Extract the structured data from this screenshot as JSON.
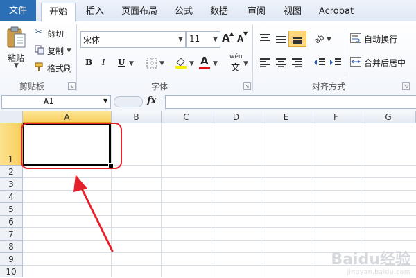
{
  "tabs": [
    "文件",
    "开始",
    "插入",
    "页面布局",
    "公式",
    "数据",
    "审阅",
    "视图",
    "Acrobat"
  ],
  "clipboard": {
    "paste": "粘贴",
    "cut": "剪切",
    "copy": "复制",
    "format_painter": "格式刷",
    "group_label": "剪贴板"
  },
  "font": {
    "name": "宋体",
    "size": "11",
    "group_label": "字体",
    "grow": "A",
    "shrink": "A",
    "bold": "B",
    "italic": "I",
    "underline": "U",
    "font_color_glyph": "A",
    "phonetic_glyph": "wén"
  },
  "alignment": {
    "wrap_text": "自动换行",
    "merge_center": "合并后居中",
    "group_label": "对齐方式"
  },
  "formula_bar": {
    "name_box": "A1",
    "fx": "fx",
    "content": ""
  },
  "sheet": {
    "columns": [
      "A",
      "B",
      "C",
      "D",
      "E",
      "F",
      "G"
    ],
    "rows": [
      "1",
      "2",
      "3",
      "4",
      "5",
      "6",
      "7",
      "8",
      "9",
      "10"
    ],
    "selected_cell": "A1"
  },
  "colors": {
    "file_tab": "#2b6fb7",
    "header_selected": "#f8cf5c",
    "annotation": "#e5212b"
  },
  "watermark": {
    "brand": "Baidu经验",
    "url": "jingyan.baidu.com"
  }
}
